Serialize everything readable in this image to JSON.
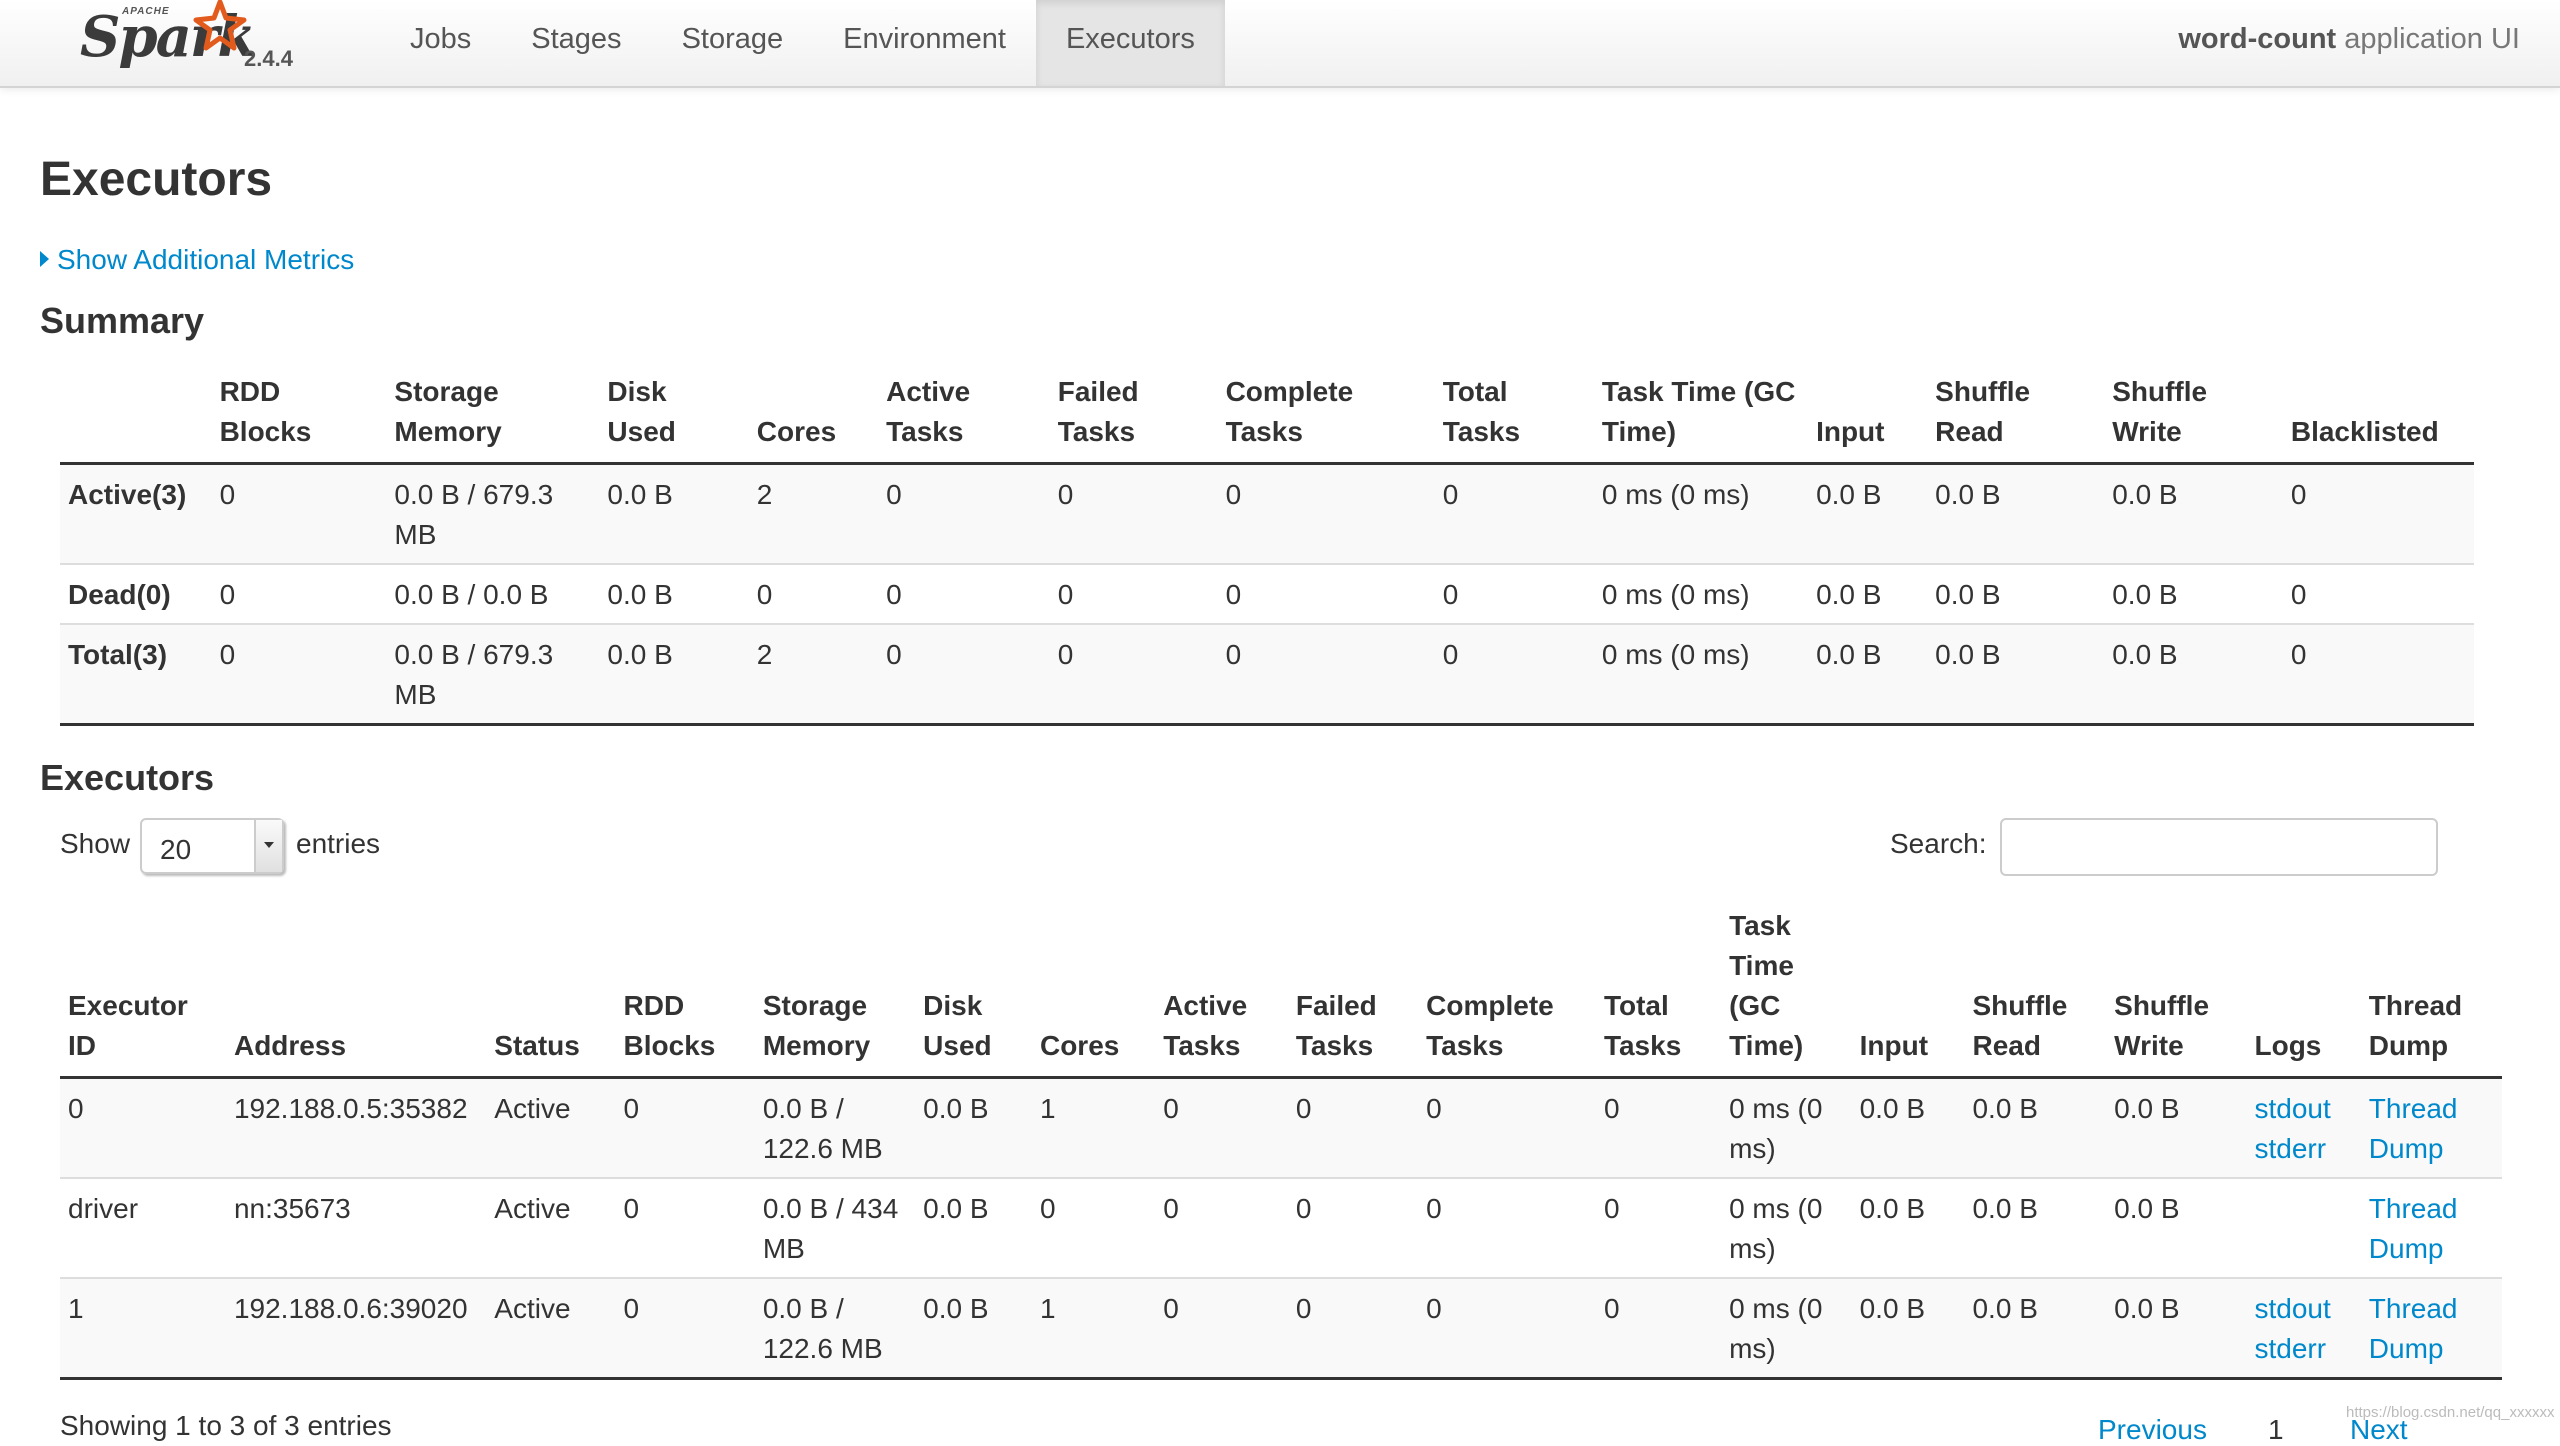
{
  "navbar": {
    "brand": {
      "apache": "APACHE",
      "name": "Spark",
      "version": "2.4.4"
    },
    "tabs": [
      {
        "label": "Jobs"
      },
      {
        "label": "Stages"
      },
      {
        "label": "Storage"
      },
      {
        "label": "Environment"
      },
      {
        "label": "Executors",
        "active": true
      }
    ],
    "app_name": {
      "bold": "word-count",
      "rest": " application UI"
    }
  },
  "page": {
    "title": "Executors",
    "additional_metrics_link": "Show Additional Metrics",
    "summary_title": "Summary",
    "executors_title": "Executors"
  },
  "summary": {
    "headers": [
      "",
      "RDD Blocks",
      "Storage Memory",
      "Disk Used",
      "Cores",
      "Active Tasks",
      "Failed Tasks",
      "Complete Tasks",
      "Total Tasks",
      "Task Time (GC Time)",
      "Input",
      "Shuffle Read",
      "Shuffle Write",
      "Blacklisted"
    ],
    "rows": [
      [
        "Active(3)",
        "0",
        "0.0 B / 679.3 MB",
        "0.0 B",
        "2",
        "0",
        "0",
        "0",
        "0",
        "0 ms (0 ms)",
        "0.0 B",
        "0.0 B",
        "0.0 B",
        "0"
      ],
      [
        "Dead(0)",
        "0",
        "0.0 B / 0.0 B",
        "0.0 B",
        "0",
        "0",
        "0",
        "0",
        "0",
        "0 ms (0 ms)",
        "0.0 B",
        "0.0 B",
        "0.0 B",
        "0"
      ],
      [
        "Total(3)",
        "0",
        "0.0 B / 679.3 MB",
        "0.0 B",
        "2",
        "0",
        "0",
        "0",
        "0",
        "0 ms (0 ms)",
        "0.0 B",
        "0.0 B",
        "0.0 B",
        "0"
      ]
    ]
  },
  "controls": {
    "show_label": "Show",
    "page_size": "20",
    "entries_label": "entries",
    "search_label": "Search:",
    "search_value": ""
  },
  "executors": {
    "headers": [
      "Executor ID",
      "Address",
      "Status",
      "RDD Blocks",
      "Storage Memory",
      "Disk Used",
      "Cores",
      "Active Tasks",
      "Failed Tasks",
      "Complete Tasks",
      "Total Tasks",
      "Task Time (GC Time)",
      "Input",
      "Shuffle Read",
      "Shuffle Write",
      "Logs",
      "Thread Dump"
    ],
    "rows": [
      {
        "cells": [
          "0",
          "192.188.0.5:35382",
          "Active",
          "0",
          "0.0 B / 122.6 MB",
          "0.0 B",
          "1",
          "0",
          "0",
          "0",
          "0",
          "0 ms (0 ms)",
          "0.0 B",
          "0.0 B",
          "0.0 B"
        ],
        "logs": [
          "stdout",
          "stderr"
        ],
        "thread_dump": "Thread Dump"
      },
      {
        "cells": [
          "driver",
          "nn:35673",
          "Active",
          "0",
          "0.0 B / 434 MB",
          "0.0 B",
          "0",
          "0",
          "0",
          "0",
          "0",
          "0 ms (0 ms)",
          "0.0 B",
          "0.0 B",
          "0.0 B"
        ],
        "logs": [],
        "thread_dump": "Thread Dump"
      },
      {
        "cells": [
          "1",
          "192.188.0.6:39020",
          "Active",
          "0",
          "0.0 B / 122.6 MB",
          "0.0 B",
          "1",
          "0",
          "0",
          "0",
          "0",
          "0 ms (0 ms)",
          "0.0 B",
          "0.0 B",
          "0.0 B"
        ],
        "logs": [
          "stdout",
          "stderr"
        ],
        "thread_dump": "Thread Dump"
      }
    ]
  },
  "footer": {
    "info": "Showing 1 to 3 of 3 entries",
    "previous": "Previous",
    "page": "1",
    "next": "Next",
    "watermark": "https://blog.csdn.net/qq_xxxxxx"
  },
  "colors": {
    "link": "#0088cc",
    "spark_star": "#e25a1c",
    "active_tab_bg": "#e5e5e5"
  }
}
